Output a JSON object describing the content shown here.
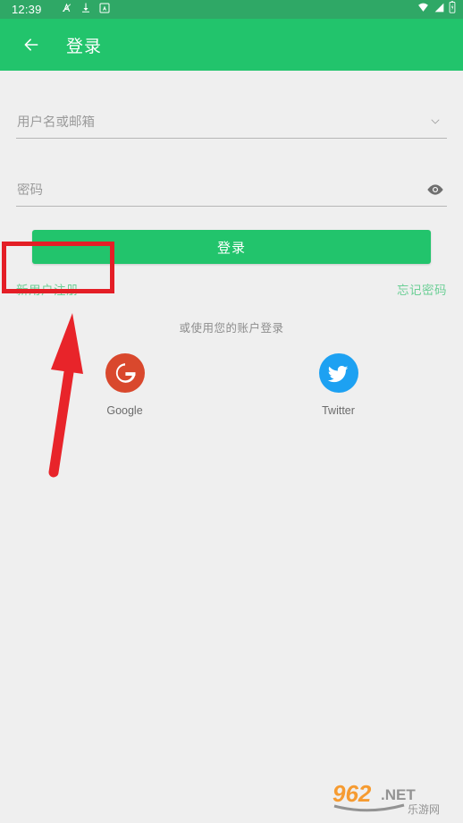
{
  "status_bar": {
    "time": "12:39",
    "left_icons": [
      "silent-mode-icon",
      "download-icon",
      "app-badge-icon"
    ],
    "right_icons": [
      "wifi-icon",
      "cellular-signal-icon",
      "battery-icon"
    ],
    "background_color": "#2fa866"
  },
  "app_bar": {
    "title": "登录",
    "back_icon": "arrow-left-icon",
    "background_color": "#22c46c",
    "title_color": "#ffffff"
  },
  "form": {
    "username": {
      "placeholder": "用户名或邮箱",
      "value": "",
      "trailing_icon": "chevron-down-icon"
    },
    "password": {
      "placeholder": "密码",
      "value": "",
      "trailing_icon": "eye-icon"
    }
  },
  "login_button": {
    "label": "登录",
    "color": "#22c46c",
    "text_color": "#ffffff"
  },
  "links": {
    "register_label": "新用户注册",
    "forgot_label": "忘记密码",
    "color": "#6ccf96"
  },
  "social": {
    "hint": "或使用您的账户登录",
    "providers": [
      {
        "label": "Google",
        "icon": "google-icon",
        "color": "#d9482d"
      },
      {
        "label": "Twitter",
        "icon": "twitter-icon",
        "color": "#1da1f2"
      }
    ]
  },
  "annotations": {
    "highlight_box": {
      "target": "新用户注册",
      "color": "#e41e26"
    },
    "arrow": {
      "points_to": "新用户注册",
      "color": "#e8242a"
    }
  },
  "watermark": {
    "number": "962",
    "suffix": ".NET",
    "subtitle": "乐游网",
    "number_color": "#f79421",
    "suffix_color": "#8c8c8c"
  },
  "background_color": "#efefef"
}
